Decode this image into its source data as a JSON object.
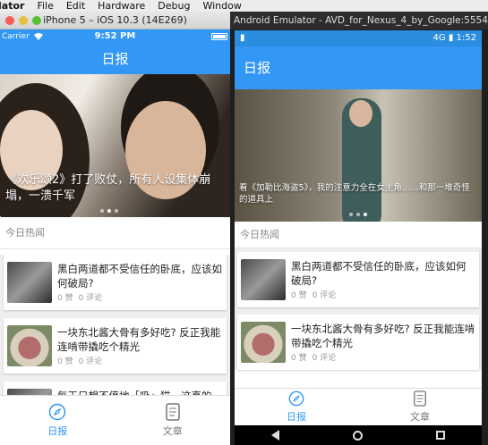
{
  "menubar": {
    "app": "lator",
    "items": [
      "File",
      "Edit",
      "Hardware",
      "Debug",
      "Window"
    ]
  },
  "ios": {
    "window_title": "iPhone 5 – iOS 10.3 (14E269)",
    "status": {
      "carrier": "Carrier",
      "time": "9:52 PM"
    },
    "nav_title": "日报",
    "hero_caption": "《欢乐颂2》打了败仗，所有人设集体崩塌，一溃千军",
    "section_title": "今日热闻",
    "articles": [
      {
        "title": "黑白两道都不受信任的卧底，应该如何破局?",
        "likes": "0 赞",
        "comments": "0 评论"
      },
      {
        "title": "一块东北酱大骨有多好吃? 反正我能连啃带撬吃个精光",
        "likes": "0 赞",
        "comments": "0 评论"
      },
      {
        "title": "每天只想不停地「吸」猫，这真的"
      }
    ],
    "tabs": [
      {
        "label": "日报"
      },
      {
        "label": "文章"
      }
    ]
  },
  "android": {
    "window_title": "Android Emulator - AVD_for_Nexus_4_by_Google:5554",
    "status": {
      "network": "4G",
      "time": "1:52"
    },
    "toolbar_title": "日报",
    "hero_caption": "看《加勒比海盗5》，我的注意力全在女主角……和那一堆奇怪的道具上",
    "section_title": "今日热闻",
    "articles": [
      {
        "title": "黑白两道都不受信任的卧底，应该如何破局?",
        "likes": "0 赞",
        "comments": "0 评论"
      },
      {
        "title": "一块东北酱大骨有多好吃? 反正我能连啃带撬吃个精光",
        "likes": "0 赞",
        "comments": "0 评论"
      }
    ],
    "tabs": [
      {
        "label": "日报"
      },
      {
        "label": "文章"
      }
    ]
  },
  "colors": {
    "accent": "#3297f5",
    "muted": "#999999"
  },
  "icons": [
    "compass-icon",
    "document-icon",
    "back-icon",
    "home-icon",
    "recents-icon",
    "wifi-icon",
    "battery-icon"
  ]
}
